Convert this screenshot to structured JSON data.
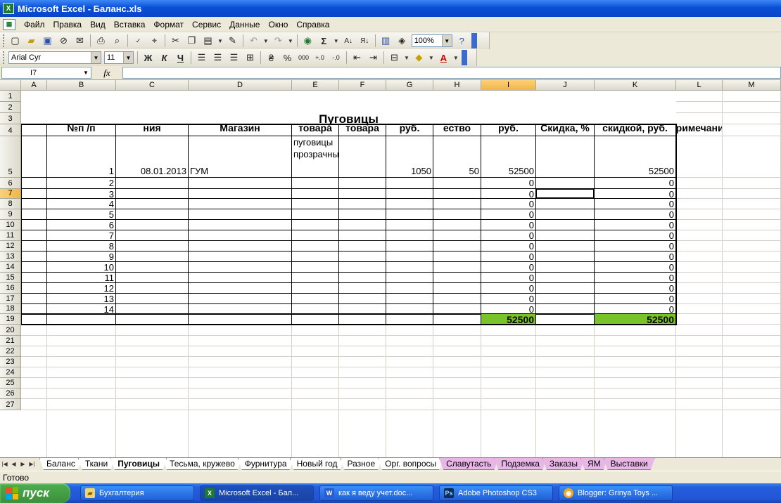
{
  "window": {
    "title": "Microsoft Excel - Баланс.xls",
    "app_icon": "excel-icon"
  },
  "menu": [
    "Файл",
    "Правка",
    "Вид",
    "Вставка",
    "Формат",
    "Сервис",
    "Данные",
    "Окно",
    "Справка"
  ],
  "toolbar": {
    "zoom": "100%",
    "font": "Arial Cyr",
    "size": "11"
  },
  "formula_bar": {
    "name_box": "I7",
    "fx": "fx",
    "value": ""
  },
  "columns": [
    "A",
    "B",
    "C",
    "D",
    "E",
    "F",
    "G",
    "H",
    "I",
    "J",
    "K",
    "L",
    "M"
  ],
  "rows": [
    "1",
    "2",
    "3",
    "4",
    "5",
    "6",
    "7",
    "8",
    "9",
    "10",
    "11",
    "12",
    "13",
    "14",
    "15",
    "16",
    "17",
    "18",
    "19",
    "20",
    "21",
    "22",
    "23",
    "24",
    "25",
    "26",
    "27"
  ],
  "sheet": {
    "title": "Пуговицы",
    "headers": {
      "a": "№п /п",
      "b": "Дата приобрете ния",
      "c": "Магазин",
      "d": "Наименование товара",
      "e": "Марка товара",
      "f": "Цена, руб.",
      "g": "Колич ество",
      "h": "Сумма, руб.",
      "i": "Скидка, %",
      "j": "Цена со скидкой, руб.",
      "k": "Примечание"
    },
    "row5": {
      "n": "1",
      "date": "08.01.2013",
      "shop": "ГУМ",
      "item_line1": "пуговицы",
      "item_line2": "прозрачные",
      "price": "1050",
      "qty": "50",
      "sum": "52500",
      "discounted": "52500"
    },
    "numbers": [
      "2",
      "3",
      "4",
      "5",
      "6",
      "7",
      "8",
      "9",
      "10",
      "11",
      "12",
      "13",
      "14"
    ],
    "zeros": "0",
    "totals": {
      "sum": "52500",
      "discounted": "52500"
    },
    "highlight_color": "#7ac22a"
  },
  "tabs": [
    "Баланс",
    "Ткани",
    "Пуговицы",
    "Тесьма, кружево",
    "Фурнитура",
    "Новый год",
    "Разное",
    "Орг. вопросы",
    "Славутасть",
    "Подземка",
    "Заказы",
    "ЯМ",
    "Выставки"
  ],
  "tab_colors": [
    "#fff",
    "#fff",
    "#fff",
    "#fff",
    "#fff",
    "#fff",
    "#fff",
    "#fff",
    "#e8b7e8",
    "#e8b7e8",
    "#e8b7e8",
    "#e8b7e8",
    "#e8b7e8"
  ],
  "status": "Готово",
  "taskbar": {
    "start": "пуск",
    "items": [
      "Бухгалтерия",
      "Microsoft Excel - Бал...",
      "как я веду учет.doc...",
      "Adobe Photoshop CS3",
      "Blogger: Grinya Toys ..."
    ]
  }
}
